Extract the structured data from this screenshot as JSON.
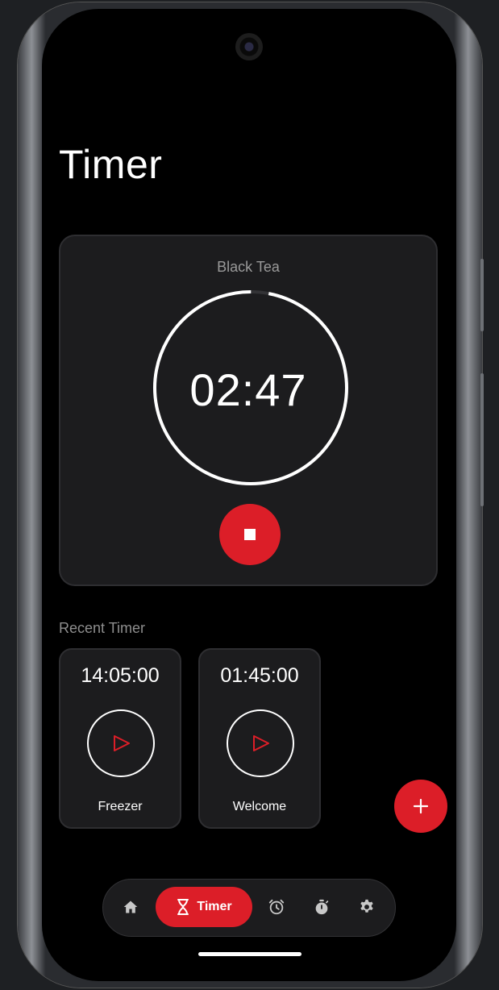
{
  "page": {
    "title": "Timer"
  },
  "active_timer": {
    "label": "Black Tea",
    "time": "02:47",
    "progress_fraction": 0.97,
    "stop_icon": "stop-icon"
  },
  "recent": {
    "title": "Recent Timer",
    "items": [
      {
        "time": "14:05:00",
        "name": "Freezer",
        "icon": "play-icon"
      },
      {
        "time": "01:45:00",
        "name": "Welcome",
        "icon": "play-icon"
      }
    ]
  },
  "fab": {
    "icon": "plus-icon"
  },
  "nav": {
    "items": [
      {
        "icon": "home-icon"
      },
      {
        "icon": "hourglass-icon",
        "label": "Timer",
        "active": true
      },
      {
        "icon": "alarm-icon"
      },
      {
        "icon": "stopwatch-icon"
      },
      {
        "icon": "settings-icon"
      }
    ]
  },
  "colors": {
    "accent": "#dc1e28",
    "background": "#000000",
    "card": "#1c1c1e",
    "muted_text": "#9a9a9a"
  }
}
